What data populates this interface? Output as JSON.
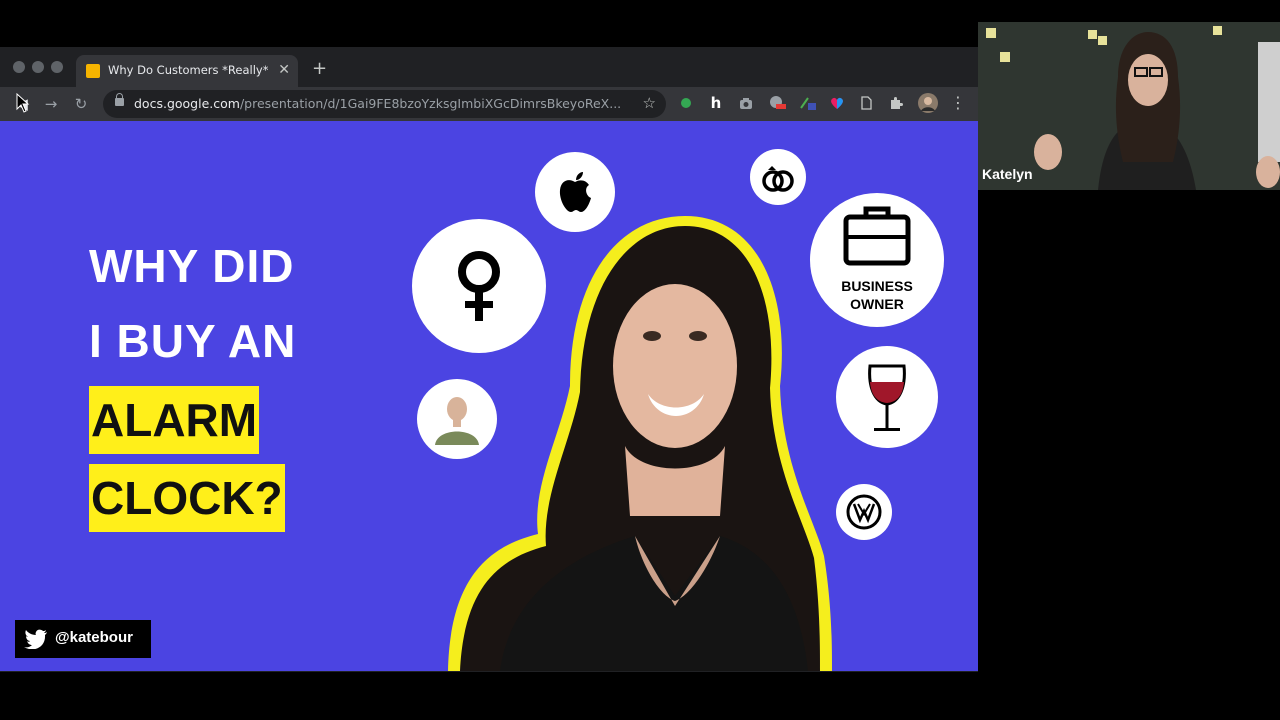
{
  "browser": {
    "tab": {
      "title": "Why Do Customers *Really* Bu",
      "close_glyph": "✕"
    },
    "new_tab_glyph": "+",
    "nav": {
      "back": "◀",
      "forward": "→",
      "reload": "↻"
    },
    "url_host": "docs.google.com",
    "url_path": "/presentation/d/1Gai9FE8bzoYzksgImbiXGcDimrsBkeyoReX...",
    "star_glyph": "☆",
    "extensions": [
      "h"
    ],
    "menu_glyph": "⋮"
  },
  "slide": {
    "headline_line1": "WHY DID",
    "headline_line2": "I BUY AN",
    "highlight_line1": "ALARM",
    "highlight_line2": "CLOCK?",
    "business_owner_line1": "BUSINESS",
    "business_owner_line2": "OWNER",
    "twitter_handle": "@katebour",
    "colors": {
      "background": "#4b44e2",
      "highlight": "#ffef1a",
      "outline": "#f5ee1d"
    }
  },
  "webcam": {
    "name": "Katelyn"
  }
}
